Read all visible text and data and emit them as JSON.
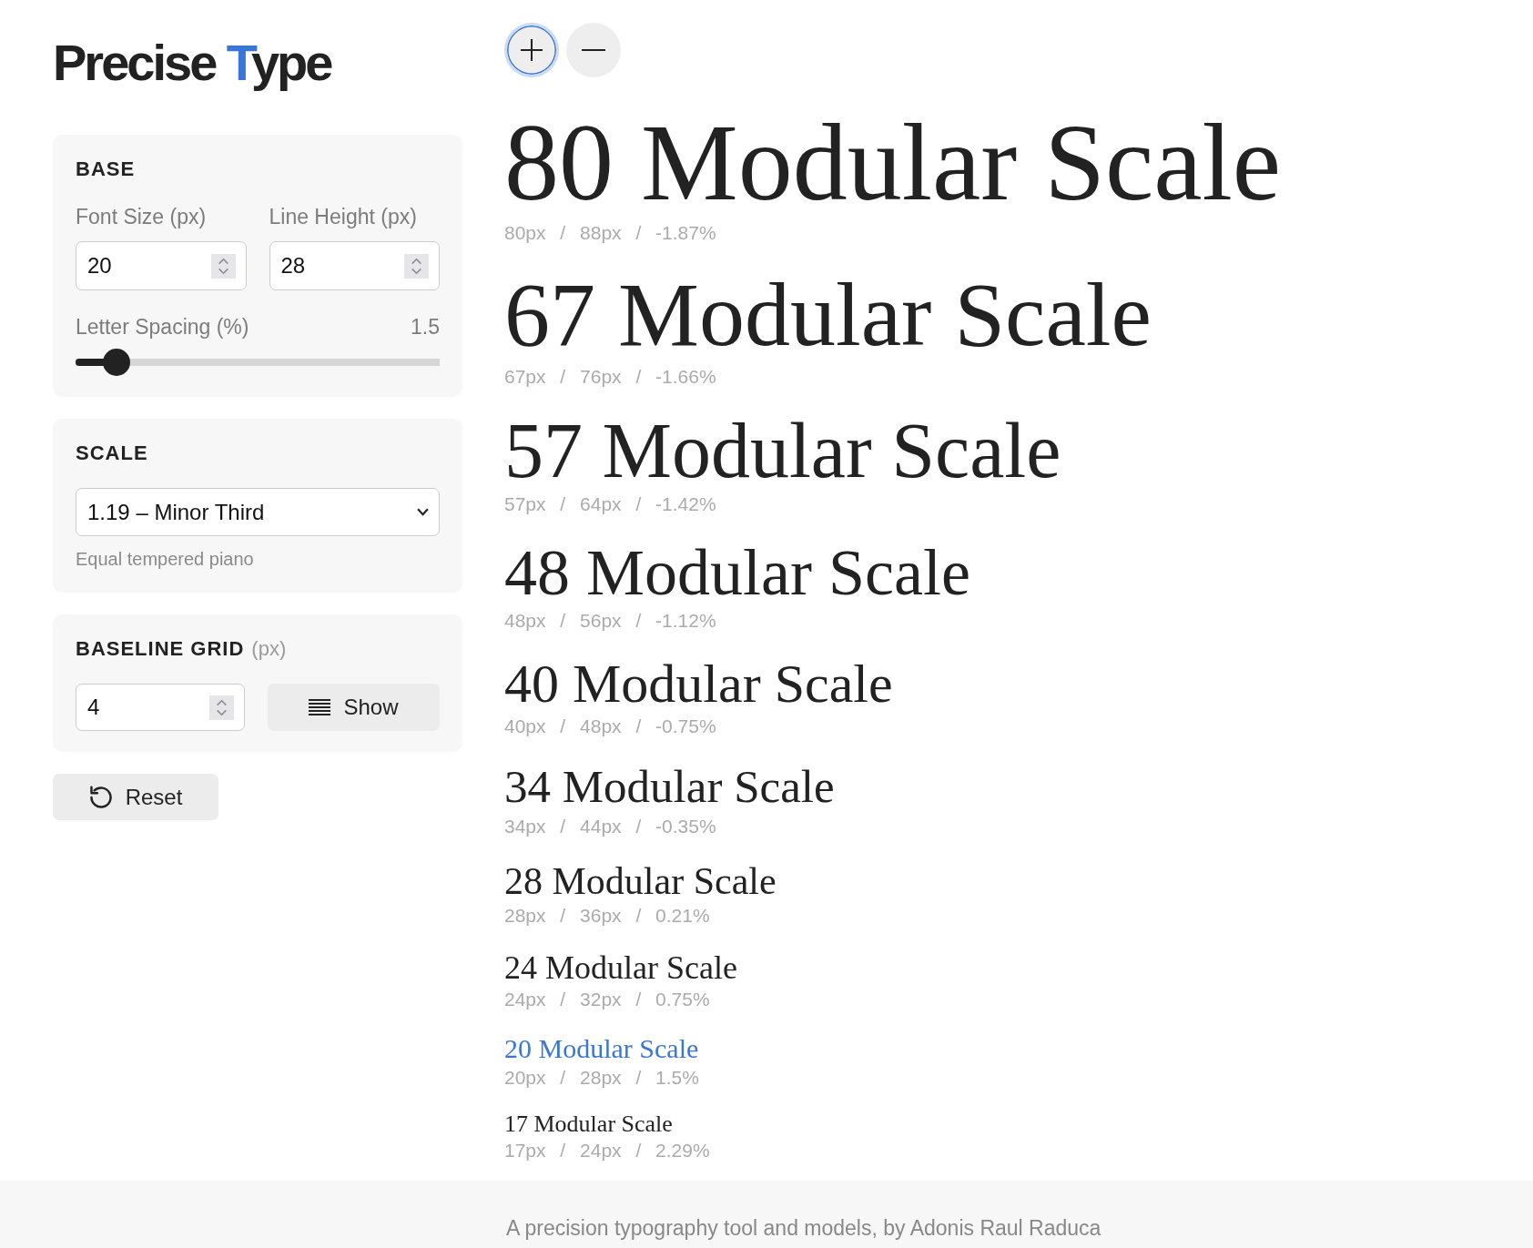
{
  "logo": {
    "parts": [
      {
        "text": "Precise ",
        "accent": false
      },
      {
        "text": "T",
        "accent": true
      },
      {
        "text": "ype",
        "accent": false
      }
    ]
  },
  "zoom_buttons": [
    {
      "kind": "plus",
      "focused": true
    },
    {
      "kind": "minus",
      "focused": false
    }
  ],
  "base": {
    "title": "BASE",
    "fields": [
      {
        "label": "Font Size (px)",
        "value": "20"
      },
      {
        "label": "Line Height (px)",
        "value": "28"
      }
    ],
    "letter_spacing": {
      "label": "Letter Spacing (%)",
      "reading": "1.5",
      "level": 0.08
    }
  },
  "scale": {
    "title": "SCALE",
    "value": "1.19 – Minor Third",
    "hint": "Equal tempered piano"
  },
  "baseline_grid": {
    "title": "BASELINE GRID",
    "unit": "(px)",
    "value": "4",
    "button": "Show"
  },
  "reset_button": "Reset",
  "scale_steps": [
    {
      "sample": "80 Modular Scale",
      "metrics": "80px / 88px / -1.87%",
      "highlighted": false
    },
    {
      "sample": "67 Modular Scale",
      "metrics": "67px / 76px / -1.66%",
      "highlighted": false
    },
    {
      "sample": "57 Modular Scale",
      "metrics": "57px / 64px / -1.42%",
      "highlighted": false
    },
    {
      "sample": "48 Modular Scale",
      "metrics": "48px / 56px / -1.12%",
      "highlighted": false
    },
    {
      "sample": "40 Modular Scale",
      "metrics": "40px / 48px / -0.75%",
      "highlighted": false
    },
    {
      "sample": "34 Modular Scale",
      "metrics": "34px / 44px / -0.35%",
      "highlighted": false
    },
    {
      "sample": "28 Modular Scale",
      "metrics": "28px / 36px / 0.21%",
      "highlighted": false
    },
    {
      "sample": "24 Modular Scale",
      "metrics": "24px / 32px / 0.75%",
      "highlighted": false
    },
    {
      "sample": "20 Modular Scale",
      "metrics": "20px / 28px / 1.5%",
      "highlighted": true
    },
    {
      "sample": "17 Modular Scale",
      "metrics": "17px / 24px / 2.29%",
      "highlighted": false
    }
  ],
  "footer": {
    "text": "A precision typography tool and models, by Adonis Raul Raduca"
  }
}
